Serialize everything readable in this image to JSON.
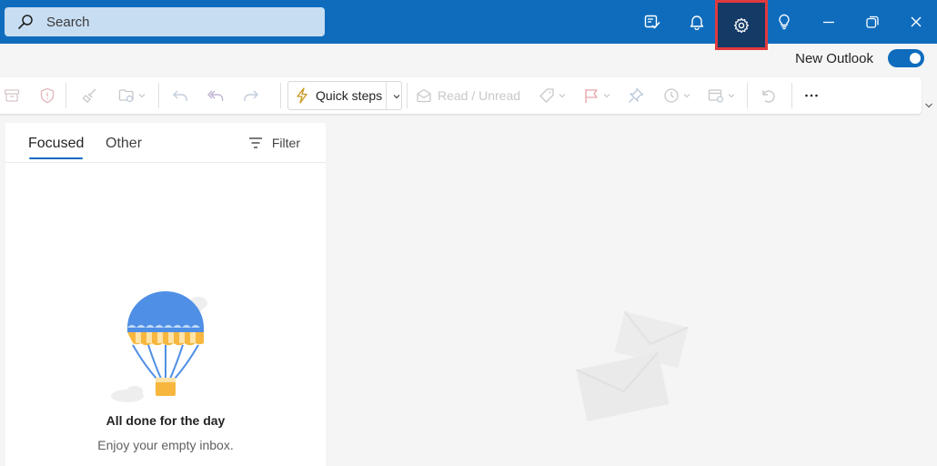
{
  "titlebar": {
    "search_placeholder": "Search",
    "buttons": [
      "my-day-icon",
      "bell-icon",
      "gear-icon",
      "lightbulb-icon",
      "minimize-icon",
      "restore-icon",
      "close-icon"
    ],
    "accent_color": "#0f6cbd",
    "highlight_color": "#e03a3e"
  },
  "new_outlook": {
    "label": "New Outlook",
    "enabled": true
  },
  "ribbon": {
    "quick_steps_label": "Quick steps",
    "read_unread_label": "Read / Unread",
    "icons": [
      "archive-icon",
      "report-icon",
      "sweep-icon",
      "move-icon",
      "undo-icon",
      "reply-all-icon",
      "forward-icon",
      "quick-steps-icon",
      "envelope-open-icon",
      "tag-icon",
      "flag-icon",
      "pin-icon",
      "snooze-icon",
      "rules-icon",
      "undo-action-icon",
      "more-icon"
    ]
  },
  "mail_list": {
    "tabs": [
      {
        "label": "Focused",
        "active": true
      },
      {
        "label": "Other",
        "active": false
      }
    ],
    "filter_label": "Filter",
    "empty_title": "All done for the day",
    "empty_subtitle": "Enjoy your empty inbox."
  }
}
